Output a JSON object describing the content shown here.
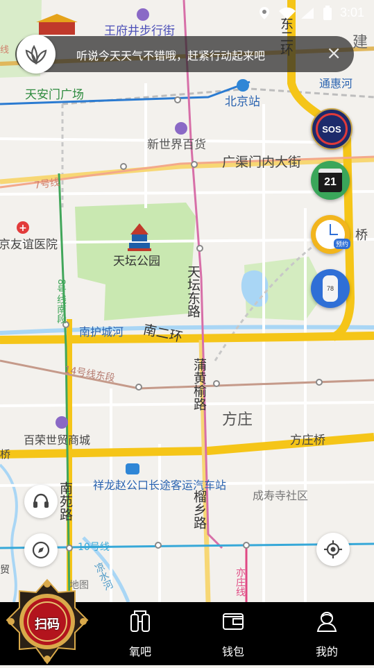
{
  "status_bar": {
    "time": "3:01"
  },
  "notice": {
    "text": "听说今天天气不错哦，赶紧行动起来吧",
    "close_glyph": "×"
  },
  "map": {
    "labels": {
      "wangfujing": "王府井步行街",
      "tiananmen_square": "天安门广场",
      "beijing_station": "北京站",
      "new_world": "新世界百货",
      "guangqumen": "广渠门内大街",
      "line7": "7号线",
      "friendship_hospital": "京友谊医院",
      "temple_of_heaven": "天坛公园",
      "tiantan_east_rd": "天坛东路",
      "line8_south": "8号线南段",
      "south_moat": "南护城河",
      "south_2nd_ring": "南二环",
      "line14_east": "14号线东段",
      "puhuangyu_rd": "蒲黄榆路",
      "fangzhuang": "方庄",
      "bairong_mall": "百荣世贸商城",
      "fangzhuang_bridge": "方庄桥",
      "zhaogongkou": "祥龙赵公口长途客运汽车站",
      "nanyuan_rd": "南苑路",
      "liuxiang_rd": "榴乡路",
      "chengshousi": "成寿寺社区",
      "line10": "10号线",
      "liangshui_river": "凉水河",
      "yizhuang_line": "亦庄线",
      "east_2nd_ring": "东二环",
      "tonghui_river": "通惠河",
      "jianguo": "建",
      "bridge_partial": "桥",
      "map_brand": "地图",
      "left_edge_a": "线",
      "left_edge_b": "桥",
      "left_edge_c": "贸"
    }
  },
  "side_buttons": {
    "sos": "SOS",
    "calendar_day": "21",
    "appointment": "预约",
    "oximeter_value": "78"
  },
  "scan_button": {
    "label": "扫码"
  },
  "tabs": [
    {
      "label": "氧吧"
    },
    {
      "label": "钱包"
    },
    {
      "label": "我的"
    }
  ],
  "colors": {
    "map_bg": "#f3f1ed",
    "ring_road": "#f5c518",
    "park": "#c9e8b1",
    "water": "#a9d6f5",
    "tab_bg": "#000000",
    "scan_red": "#b3141d",
    "gold": "#d9a94a"
  }
}
